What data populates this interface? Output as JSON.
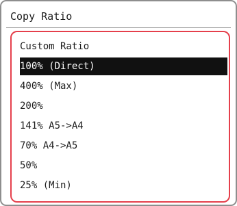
{
  "screen": {
    "title": "Copy Ratio"
  },
  "options": [
    {
      "label": "Custom Ratio",
      "selected": false
    },
    {
      "label": "100% (Direct)",
      "selected": true
    },
    {
      "label": "400% (Max)",
      "selected": false
    },
    {
      "label": "200%",
      "selected": false
    },
    {
      "label": "141% A5->A4",
      "selected": false
    },
    {
      "label": "70% A4->A5",
      "selected": false
    },
    {
      "label": "50%",
      "selected": false
    },
    {
      "label": "25% (Min)",
      "selected": false
    }
  ],
  "colors": {
    "list_border": "#e53f4b",
    "selected_background": "#111111",
    "selected_text": "#ffffff",
    "text": "#1b1b1b",
    "frame_border": "#8e8e8e"
  }
}
